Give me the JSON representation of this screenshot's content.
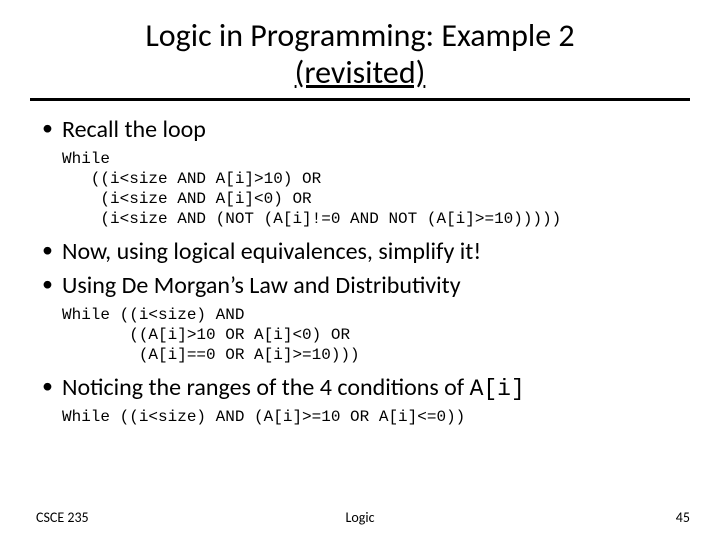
{
  "title_line1": "Logic in Programming: Example 2",
  "title_line2": "(revisited)",
  "bullets": {
    "b1": "Recall the loop",
    "code1": "While\n   ((i<size AND A[i]>10) OR\n    (i<size AND A[i]<0) OR\n    (i<size AND (NOT (A[i]!=0 AND NOT (A[i]>=10)))))",
    "b2": "Now, using logical equivalences, simplify it!",
    "b3_prefix": "Using De Morgan",
    "b3_suffix": "s Law and Distributivity",
    "code2": "While ((i<size) AND\n       ((A[i]>10 OR A[i]<0) OR\n        (A[i]==0 OR A[i]>=10)))",
    "b4_prefix": "Noticing the ranges of the 4 conditions of ",
    "b4_code": "A[i]",
    "code3": "While ((i<size) AND (A[i]>=10 OR A[i]<=0))"
  },
  "footer": {
    "left": "CSCE 235",
    "center": "Logic",
    "right": "45"
  }
}
